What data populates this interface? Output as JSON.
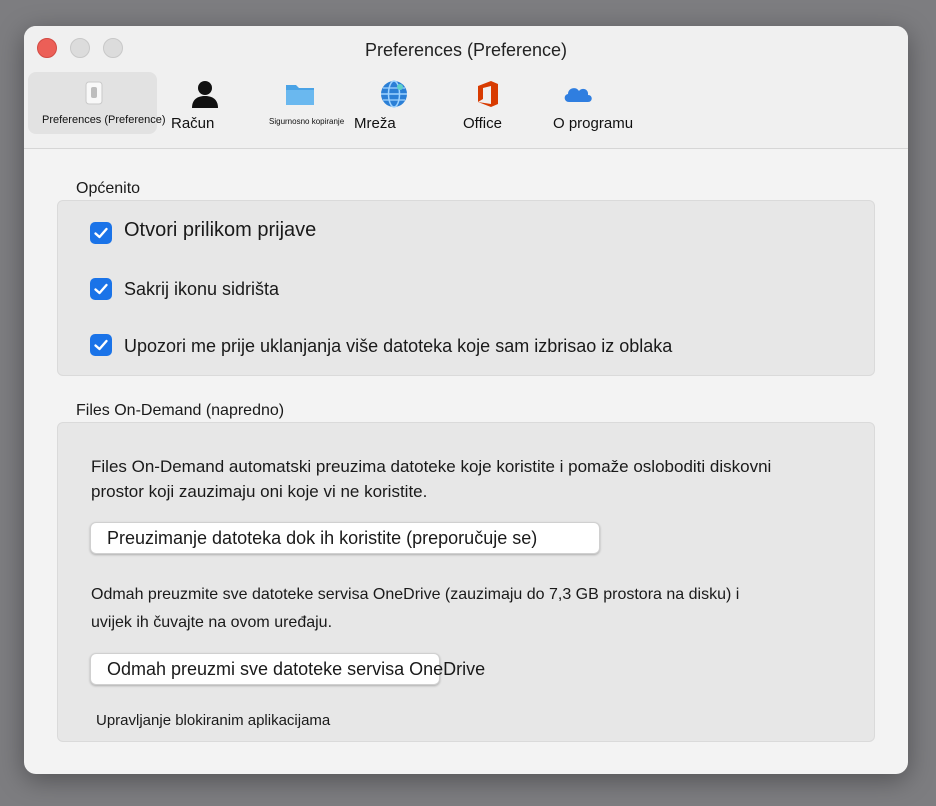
{
  "window": {
    "title": "Preferences (Preference)"
  },
  "tabs": [
    {
      "label": "Preferences (Preference)",
      "icon": "switch-icon"
    },
    {
      "label": "Račun",
      "icon": "person-icon"
    },
    {
      "label": "Sigurnosno kopiranje",
      "icon": "folder-icon"
    },
    {
      "label": "Mreža",
      "icon": "globe-icon"
    },
    {
      "label": "Office",
      "icon": "office-icon"
    },
    {
      "label": "O programu",
      "icon": "cloud-icon"
    }
  ],
  "general": {
    "title": "Općenito",
    "options": [
      {
        "label": "Otvori prilikom prijave",
        "checked": true
      },
      {
        "label": "Sakrij ikonu sidrišta",
        "checked": true
      },
      {
        "label": "Upozori me prije uklanjanja više datoteka koje sam izbrisao iz oblaka",
        "checked": true
      }
    ]
  },
  "files_on_demand": {
    "title": "Files On-Demand (napredno)",
    "description_line1": "Files On-Demand automatski preuzima datoteke koje koristite i pomaže osloboditi diskovni",
    "description_line2": "prostor koji zauzimaju oni koje vi ne koristite.",
    "download_on_use_button": "Preuzimanje datoteka dok ih koristite (preporučuje se)",
    "download_all_text_line1": "Odmah preuzmite sve datoteke servisa OneDrive (zauzimaju do 7,3 GB prostora na disku) i",
    "download_all_text_line2": "uvijek ih čuvajte na ovom uređaju.",
    "download_all_button": "Odmah preuzmi sve datoteke servisa OneDrive",
    "manage_blocked_apps": "Upravljanje blokiranim aplikacijama"
  },
  "colors": {
    "checkbox_blue": "#1a73e8",
    "office_red": "#d83b01",
    "onedrive_blue": "#2f7ee0"
  }
}
